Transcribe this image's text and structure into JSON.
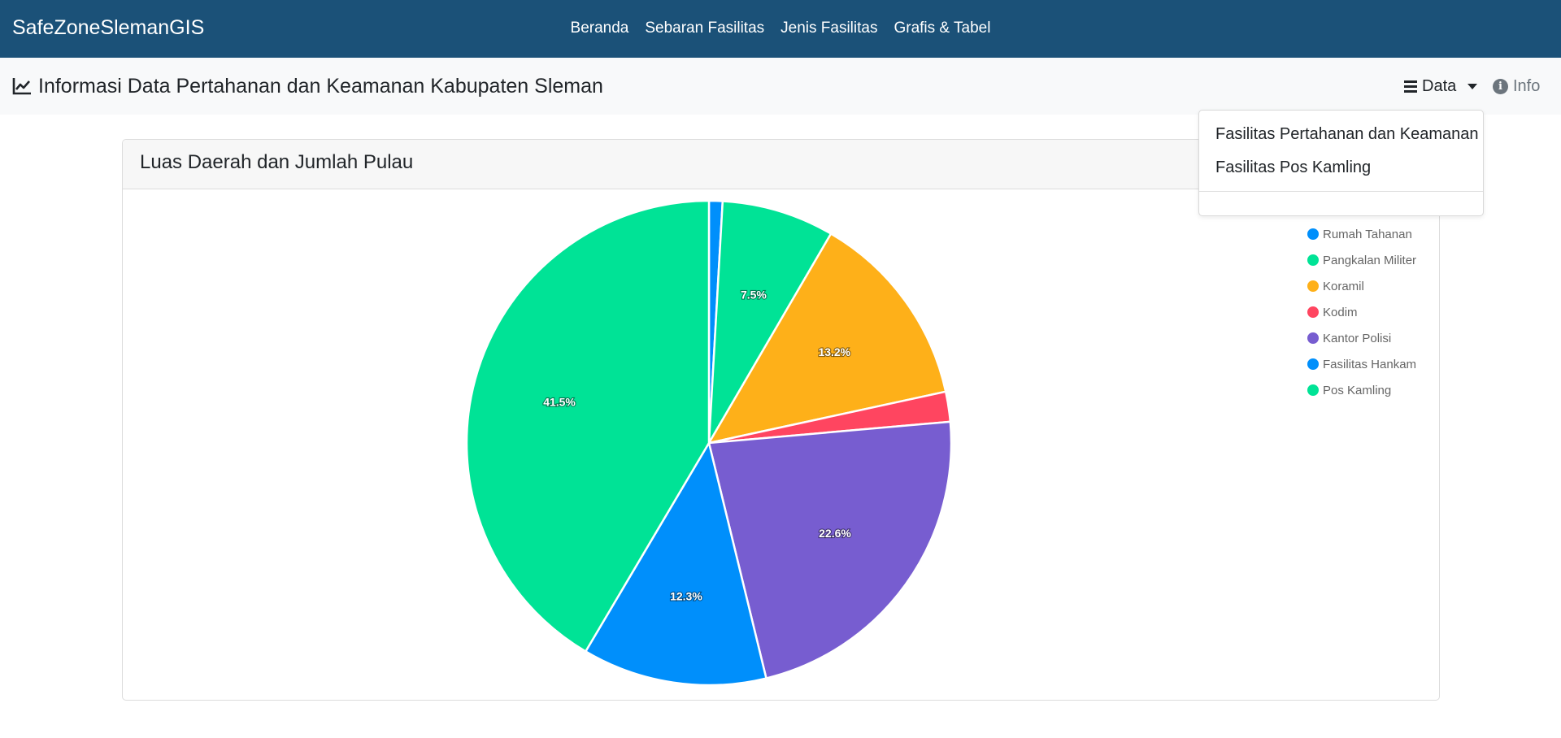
{
  "navbar": {
    "brand": "SafeZoneSlemanGIS",
    "links": [
      "Beranda",
      "Sebaran Fasilitas",
      "Jenis Fasilitas",
      "Grafis & Tabel"
    ]
  },
  "subheader": {
    "title": "Informasi Data Pertahanan dan Keamanan Kabupaten Sleman",
    "title_icon": "chart-line-icon",
    "data_menu_label": "Data",
    "data_menu_icon": "bars-icon",
    "info_label": "Info",
    "info_icon": "info-circle-icon"
  },
  "dropdown": {
    "items": [
      "Fasilitas Pertahanan dan Keamanan",
      "Fasilitas Pos Kamling"
    ]
  },
  "card": {
    "title": "Luas Daerah dan Jumlah Pulau"
  },
  "colors": {
    "navbar_bg": "#1b5178",
    "blue": "#008ffb",
    "green": "#00e396",
    "orange": "#feb019",
    "red": "#ff4560",
    "purple": "#775dd0"
  },
  "chart_data": {
    "type": "pie",
    "categories": [
      "Rumah Tahanan",
      "Pangkalan Militer",
      "Koramil",
      "Kodim",
      "Kantor Polisi",
      "Fasilitas Hankam",
      "Pos Kamling"
    ],
    "values": [
      0.9,
      7.5,
      13.2,
      2.0,
      22.6,
      12.3,
      41.5
    ],
    "data_labels": [
      "",
      "7.5%",
      "13.2%",
      "",
      "22.6%",
      "12.3%",
      "41.5%"
    ],
    "colors": [
      "#008ffb",
      "#00e396",
      "#feb019",
      "#ff4560",
      "#775dd0",
      "#008ffb",
      "#00e396"
    ],
    "legend_position": "right"
  }
}
